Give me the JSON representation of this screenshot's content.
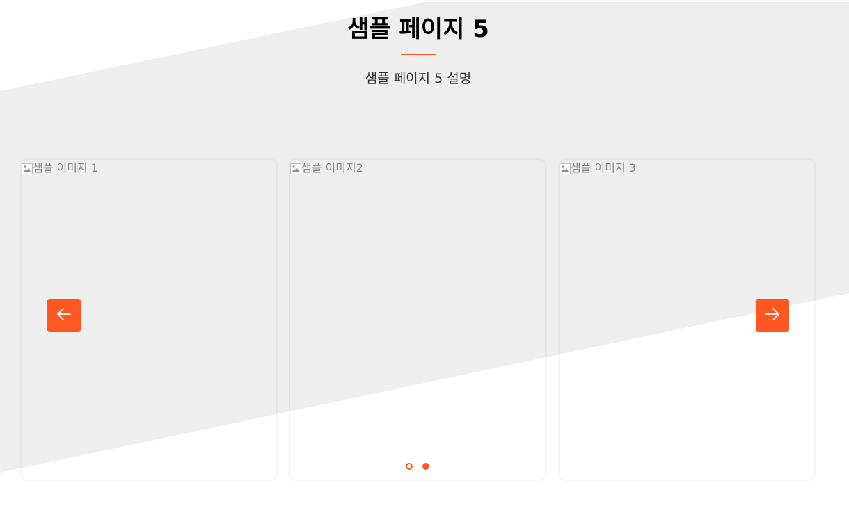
{
  "header": {
    "title": "샘플 페이지 5",
    "description": "샘플 페이지 5 설명"
  },
  "colors": {
    "accent": "#ff5722",
    "slant_bg": "#eeeeee",
    "page_bg": "#ffffff"
  },
  "carousel": {
    "cards": [
      {
        "alt": "샘플 이미지 1"
      },
      {
        "alt": "샘플 이미지2"
      },
      {
        "alt": "샘플 이미지 3"
      }
    ],
    "prev_icon": "arrow-left-icon",
    "next_icon": "arrow-right-icon",
    "pagination": {
      "count": 2,
      "active_index": 1
    }
  }
}
